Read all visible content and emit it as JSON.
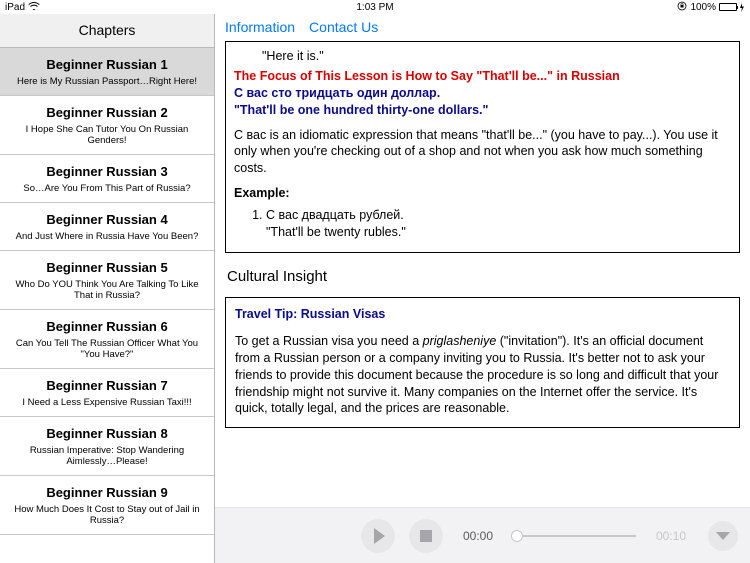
{
  "status": {
    "device": "iPad",
    "time": "1:03 PM",
    "battery_pct": "100%"
  },
  "sidebar": {
    "title": "Chapters",
    "chapters": [
      {
        "title": "Beginner Russian 1",
        "sub": "Here is My Russian Passport…Right Here!",
        "selected": true
      },
      {
        "title": "Beginner Russian 2",
        "sub": "I Hope She Can Tutor You On Russian Genders!",
        "selected": false
      },
      {
        "title": "Beginner Russian 3",
        "sub": "So…Are You From This Part of Russia?",
        "selected": false
      },
      {
        "title": "Beginner Russian 4",
        "sub": "And Just Where in Russia Have You Been?",
        "selected": false
      },
      {
        "title": "Beginner Russian 5",
        "sub": "Who Do YOU Think You Are Talking To Like That in Russia?",
        "selected": false
      },
      {
        "title": "Beginner Russian 6",
        "sub": "Can You Tell The Russian Officer What You \"You Have?\"",
        "selected": false
      },
      {
        "title": "Beginner Russian 7",
        "sub": "I Need a Less Expensive Russian Taxi!!!",
        "selected": false
      },
      {
        "title": "Beginner Russian 8",
        "sub": "Russian Imperative: Stop Wandering Aimlessly…Please!",
        "selected": false
      },
      {
        "title": "Beginner Russian 9",
        "sub": "How Much Does It Cost to Stay out of Jail in Russia?",
        "selected": false
      }
    ]
  },
  "links": {
    "information": "Information",
    "contact": "Contact Us"
  },
  "lesson": {
    "here_it_is": "\"Here it is.\"",
    "focus": "The Focus of This Lesson is How to Say \"That'll be...\" in Russian",
    "russian_line": "С вас сто тридцать один доллар.",
    "english_line": "\"That'll be one hundred thirty-one dollars.\"",
    "body": "С вас is an idiomatic expression that means \"that'll be...\" (you have to pay...). You use it only when you're checking out of a shop and not when you ask how much something costs.",
    "example_label": "Example:",
    "example_ru": "С вас двадцать рублей.",
    "example_en": "\"That'll be twenty rubles.\""
  },
  "insight": {
    "heading": "Cultural Insight",
    "title": "Travel Tip: Russian Visas",
    "body_pre": "To get a Russian visa you need a ",
    "body_term": "priglasheniye",
    "body_post": " (\"invitation\"). It's an official document from a Russian person or a company inviting you to Russia. It's better not to ask your friends to provide this document because the procedure is so long and difficult that your friendship might not survive it. Many companies on the Internet offer the service. It's quick, totally legal, and the prices are reasonable."
  },
  "player": {
    "current": "00:00",
    "total": "00:10"
  }
}
